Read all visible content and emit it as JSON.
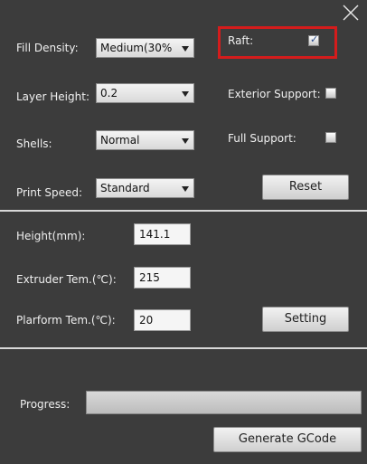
{
  "settings": {
    "fill_density": {
      "label": "Fill Density:",
      "value": "Medium(30%"
    },
    "layer_height": {
      "label": "Layer Height:",
      "value": "0.2"
    },
    "shells": {
      "label": "Shells:",
      "value": "Normal"
    },
    "print_speed": {
      "label": "Print Speed:",
      "value": "Standard"
    }
  },
  "options": {
    "raft": {
      "label": "Raft:",
      "checked": true
    },
    "exterior_support": {
      "label": "Exterior Support:",
      "checked": false
    },
    "full_support": {
      "label": "Full Support:",
      "checked": false
    },
    "reset_label": "Reset"
  },
  "temps": {
    "height": {
      "label": "Height(mm):",
      "value": "141.1"
    },
    "extruder": {
      "label": "Extruder Tem.(℃):",
      "value": "215"
    },
    "platform": {
      "label": "Plarform Tem.(℃):",
      "value": "20"
    },
    "setting_label": "Setting"
  },
  "bottom": {
    "progress_label": "Progress:",
    "progress_value": 0,
    "generate_label": "Generate GCode"
  },
  "icons": {
    "close": "close-icon",
    "dropdown": "chevron-down-icon",
    "checkmark": "check-icon"
  },
  "colors": {
    "background": "#3c3c3c",
    "highlight": "#d41c1c",
    "divider": "#d8d8d8"
  }
}
